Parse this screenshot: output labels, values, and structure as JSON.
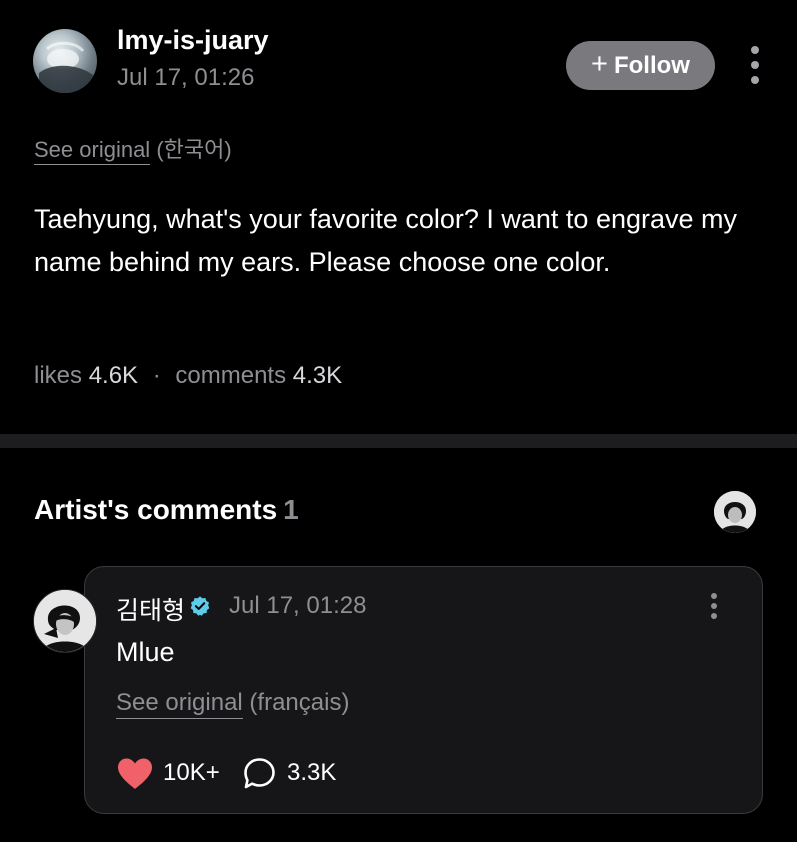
{
  "post": {
    "username": "lmy-is-juary",
    "timestamp": "Jul 17, 01:26",
    "follow_label": "Follow",
    "follow_plus": "+",
    "translation": {
      "link_label": "See original",
      "language": "(한국어)"
    },
    "body": "Taehyung, what's your favorite color? I want to engrave my name behind my ears. Please choose one color.",
    "stats": {
      "likes_label": "likes",
      "likes_value": "4.6K",
      "separator": "·",
      "comments_label": "comments",
      "comments_value": "4.3K"
    }
  },
  "artist_section": {
    "title": "Artist's comments",
    "count": "1"
  },
  "artist_comment": {
    "author": "김태형",
    "timestamp": "Jul 17, 01:28",
    "text": "Mlue",
    "translation": {
      "link_label": "See original",
      "language": "(français)"
    },
    "likes": "10K+",
    "replies": "3.3K"
  },
  "icons": {
    "follow": "plus-icon",
    "more": "more-vertical-icon",
    "verified": "verified-badge-icon",
    "like": "heart-icon",
    "reply": "comment-bubble-icon"
  },
  "colors": {
    "background": "#000000",
    "follow_button": "#7a7a7e",
    "secondary_text": "#8e8e93",
    "card_background": "#161618",
    "heart": "#f0616a",
    "verified": "#5ecbe8"
  }
}
